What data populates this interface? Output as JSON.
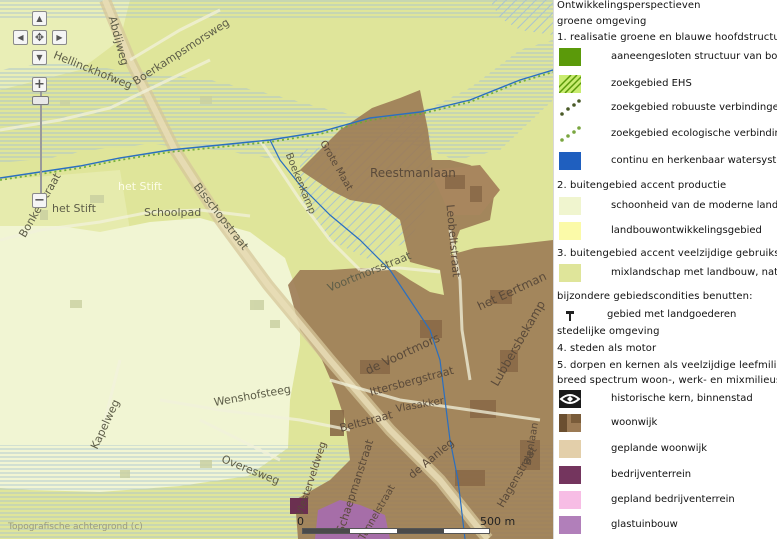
{
  "map": {
    "streets": {
      "abdijweg": "Abdijweg",
      "boerkampsmorsweg": "Boerkampsmorsweg",
      "hellinckhofweg": "Hellinckhofweg",
      "het_stift_1": "het Stift",
      "het_stift_2": "het Stift",
      "bonkesstraat": "Bonkesstraat",
      "schoolpad": "Schoolpad",
      "bisschopstraat": "Bisschopstraat",
      "boekenkamp": "Boekenkamp",
      "grote_maat": "Grote Maat",
      "reestmanlaan": "Reestmanlaan",
      "leobeltstraat": "Leobeltstraat",
      "voortmorsstraat": "Voortmorsstraat",
      "het_eertman": "het Eertman",
      "de_voortmors": "de Voortmors",
      "lubbersbekamp": "Lubbersbekamp",
      "ittersbergstraat": "Ittersbergstraat",
      "wenshofsteeg": "Wenshofsteeg",
      "kapelweg": "Kapelweg",
      "overesweg": "Overesweg",
      "beltstraat": "Beltstraat",
      "vlasakker": "Vlasakker",
      "de_aanleg": "de Aanleg",
      "blenlaan": "Blenlaan",
      "hagenstraat": "Hagenstraat",
      "schaepmanstraat": "Schaepmanstraat",
      "vlesterveldweg": "Vlesterveldweg",
      "tunnelstraat": "Tunnelstraat"
    },
    "copyright": "Topografische achtergrond (c)",
    "scale": {
      "start": "0",
      "end": "500 m"
    },
    "controls": {
      "zoom_in": "+",
      "zoom_out": "−",
      "pan_up": "▲",
      "pan_down": "▼",
      "pan_left": "◀",
      "pan_right": "▶",
      "center": "✥"
    }
  },
  "legend": {
    "title": "Ontwikkelingsperspectieven",
    "section_green": "groene omgeving",
    "h1": "1. realisatie groene en blauwe hoofdstructuur",
    "h2": "2. buitengebied accent productie",
    "h3": "3. buitengebied accent veelzijdige gebruiksruimte",
    "special": "bijzondere gebiedscondities benutten:",
    "urban": "stedelijke omgeving",
    "h4": "4. steden als motor",
    "h5": "5. dorpen en kernen als veelzijdige leefmilieus",
    "broad": "breed spectrum woon-, werk- en mixmilieus",
    "items": {
      "aaneengesloten": "aaneengesloten structuur van bos en natuur",
      "zoekgebied_ehs": "zoekgebied EHS",
      "robuuste": "zoekgebied robuuste verbindingen",
      "ecologische": "zoekgebied ecologische verbindingszones",
      "watersysteem": "continu en herkenbaar watersysteem",
      "schoonheid": "schoonheid van de moderne landbouw",
      "landbouw": "landbouwontwikkelingsgebied",
      "mixlandschap": "mixlandschap met landbouw, natuur en wonen",
      "landgoederen": "gebied met landgoederen",
      "historische": "historische kern, binnenstad",
      "woonwijk": "woonwijk",
      "geplande_woonwijk": "geplande woonwijk",
      "bedrijventerrein": "bedrijventerrein",
      "gepland_bedrijventerrein": "gepland bedrijventerrein",
      "glastuinbouw": "glastuinbouw"
    },
    "colors": {
      "aaneengesloten": "#5b9a0a",
      "zoekgebied_ehs": "#a8d850",
      "dots": "#4a6a20",
      "watersysteem": "#1f5fbf",
      "schoonheid": "#f0f5cf",
      "landbouw": "#fbfaa8",
      "mixlandschap": "#dfe59a",
      "woonwijk": "#9c7b55",
      "geplande_woonwijk": "#e3cfaa",
      "bedrijventerrein": "#74355e",
      "gepland_bedrijventerrein": "#f7bde5",
      "glastuinbouw": "#b17fba"
    }
  }
}
